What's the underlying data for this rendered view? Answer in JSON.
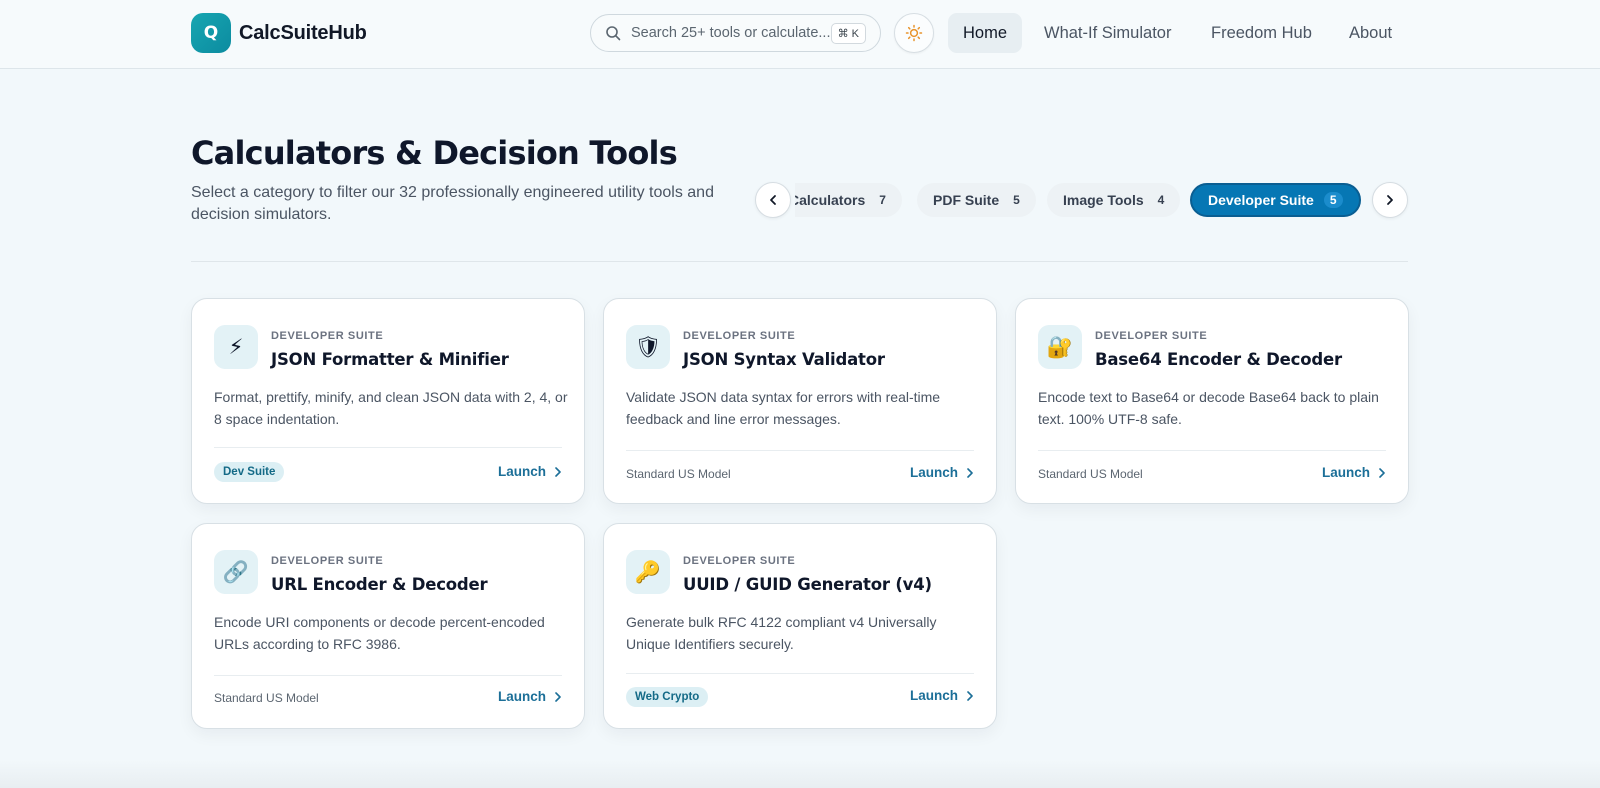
{
  "header": {
    "logo_letter": "Q",
    "brand": "CalcSuiteHub",
    "search_placeholder": "Search 25+ tools or calculate...",
    "search_shortcut": "⌘ K",
    "nav": [
      "Home",
      "What-If Simulator",
      "Freedom Hub",
      "About"
    ],
    "active_nav": "Home"
  },
  "main": {
    "title": "Calculators & Decision Tools",
    "subtitle": "Select a category to filter our 32 professionally engineered utility tools and decision simulators.",
    "categories": [
      {
        "label": "Calculators",
        "count": "7"
      },
      {
        "label": "PDF Suite",
        "count": "5"
      },
      {
        "label": "Image Tools",
        "count": "4"
      },
      {
        "label": "Developer Suite",
        "count": "5",
        "active": true
      }
    ]
  },
  "cards": [
    {
      "icon": "lightning-icon",
      "glyph": "⚡",
      "category": "DEVELOPER SUITE",
      "title": "JSON Formatter & Minifier",
      "desc": "Format, prettify, minify, and clean JSON data with 2, 4, or 8 space indentation.",
      "footer_tag": "Dev Suite",
      "launch": "Launch"
    },
    {
      "icon": "shield-icon",
      "glyph": "🛡",
      "category": "DEVELOPER SUITE",
      "title": "JSON Syntax Validator",
      "desc": "Validate JSON data syntax for errors with real-time feedback and line error messages.",
      "footer_text": "Standard US Model",
      "launch": "Launch"
    },
    {
      "icon": "lock-icon",
      "glyph": "🔐",
      "category": "DEVELOPER SUITE",
      "title": "Base64 Encoder & Decoder",
      "desc": "Encode text to Base64 or decode Base64 back to plain text. 100% UTF-8 safe.",
      "footer_text": "Standard US Model",
      "launch": "Launch"
    },
    {
      "icon": "link-icon",
      "glyph": "🔗",
      "category": "DEVELOPER SUITE",
      "title": "URL Encoder & Decoder",
      "desc": "Encode URI components or decode percent-encoded URLs according to RFC 3986.",
      "footer_text": "Standard US Model",
      "launch": "Launch"
    },
    {
      "icon": "key-icon",
      "glyph": "🔑",
      "category": "DEVELOPER SUITE",
      "title": "UUID / GUID Generator (v4)",
      "desc": "Generate bulk RFC 4122 compliant v4 Universally Unique Identifiers securely.",
      "footer_tag": "Web Crypto",
      "launch": "Launch"
    }
  ],
  "colors": {
    "accent": "#0677b4",
    "teal": "#17a6b1",
    "link": "#1c6f98"
  }
}
